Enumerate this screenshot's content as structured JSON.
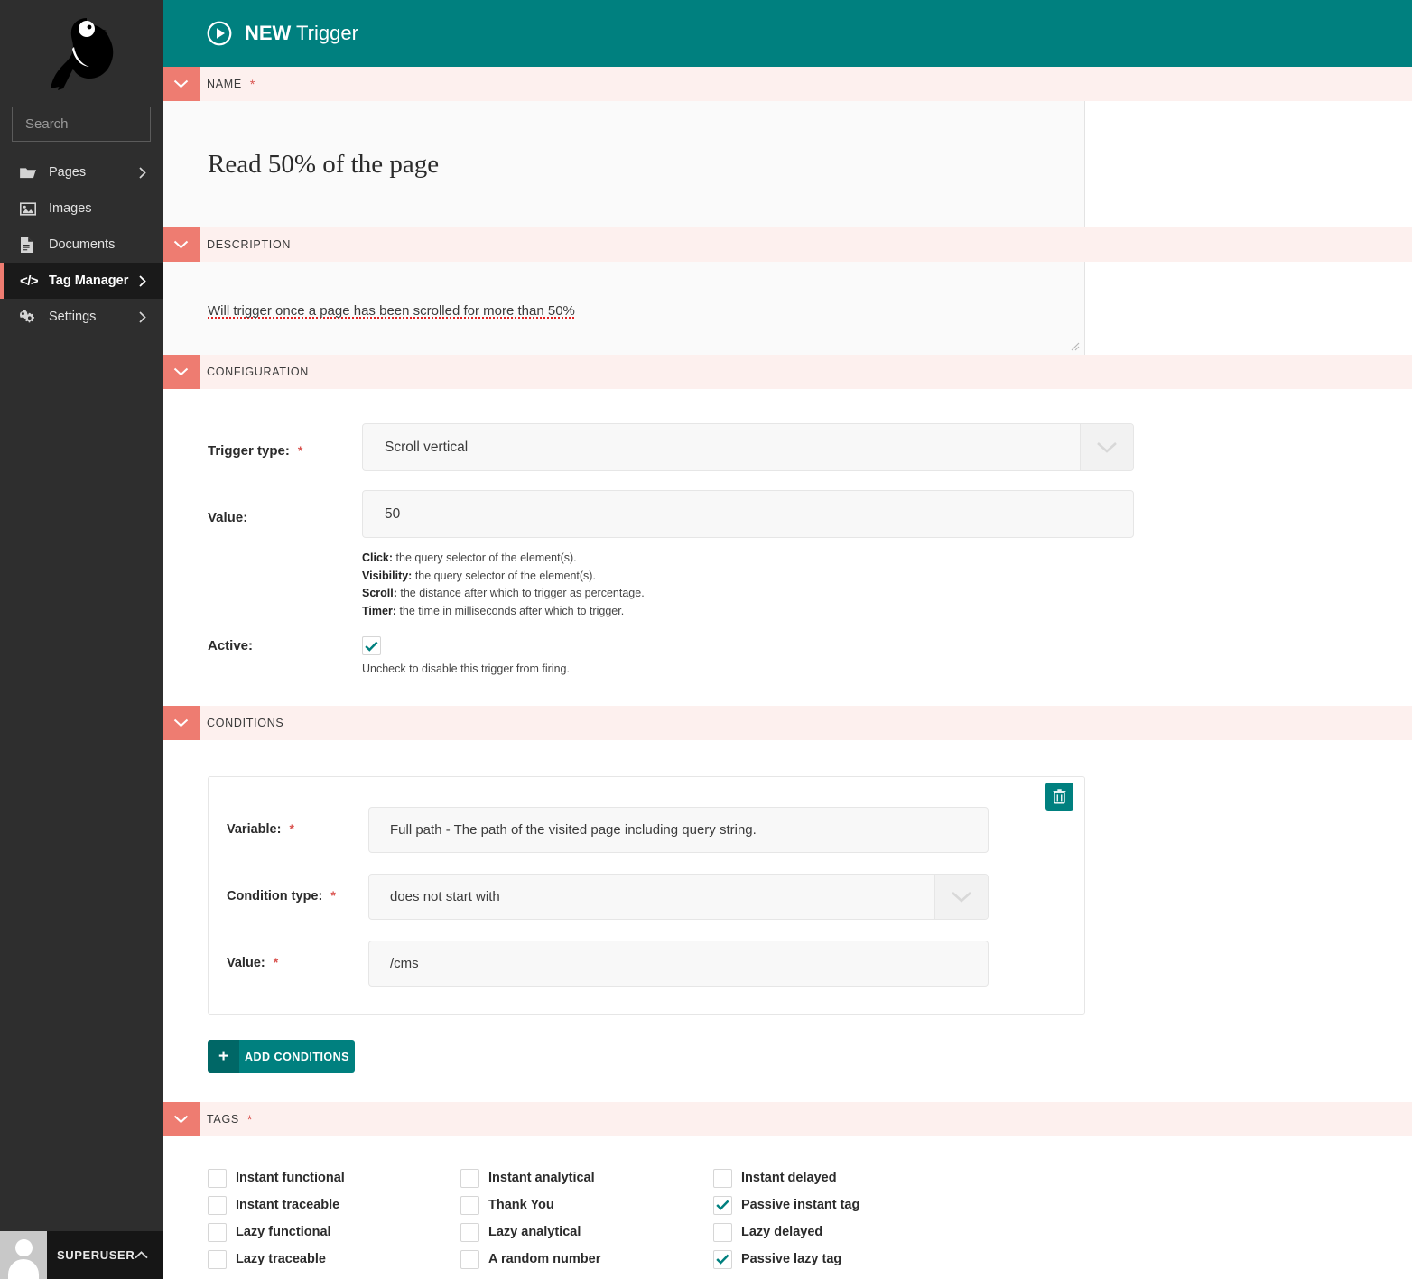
{
  "sidebar": {
    "logo": "bird-logo",
    "search": {
      "placeholder": "Search",
      "value": "",
      "icon": "search-icon"
    },
    "items": [
      {
        "label": "Pages",
        "icon": "folder-open-icon",
        "has_chevron": true,
        "active": false
      },
      {
        "label": "Images",
        "icon": "image-icon",
        "has_chevron": false,
        "active": false
      },
      {
        "label": "Documents",
        "icon": "document-icon",
        "has_chevron": false,
        "active": false
      },
      {
        "label": "Tag Manager",
        "icon": "code-icon",
        "has_chevron": true,
        "active": true
      },
      {
        "label": "Settings",
        "icon": "gears-icon",
        "has_chevron": true,
        "active": false
      }
    ],
    "user": {
      "name": "SUPERUSER",
      "chevron": "chevron-up-icon"
    }
  },
  "topbar": {
    "icon": "play-circle-icon",
    "title_bold": "NEW",
    "title_rest": " Trigger",
    "background": "#00807f"
  },
  "sections": {
    "name": {
      "title": "NAME",
      "required": true,
      "toggle": "chevron-down-icon"
    },
    "description": {
      "title": "DESCRIPTION",
      "required": false,
      "toggle": "chevron-down-icon"
    },
    "configuration": {
      "title": "CONFIGURATION",
      "required": false,
      "toggle": "chevron-down-icon"
    },
    "conditions": {
      "title": "CONDITIONS",
      "required": false,
      "toggle": "chevron-down-icon"
    },
    "tags": {
      "title": "TAGS",
      "required": true,
      "toggle": "chevron-down-icon"
    }
  },
  "name": {
    "value": "Read 50% of the page"
  },
  "description": {
    "value": "Will trigger once a page has been scrolled for more than 50%"
  },
  "configuration": {
    "trigger_type": {
      "label": "Trigger type:",
      "required": true,
      "value": "Scroll vertical",
      "arrow": "chevron-down-icon"
    },
    "value": {
      "label": "Value:",
      "required": false,
      "value": "50"
    },
    "hints": [
      {
        "term": "Click:",
        "text": " the query selector of the element(s)."
      },
      {
        "term": "Visibility:",
        "text": " the query selector of the element(s)."
      },
      {
        "term": "Scroll:",
        "text": " the distance after which to trigger as percentage."
      },
      {
        "term": "Timer:",
        "text": " the time in milliseconds after which to trigger."
      }
    ],
    "active": {
      "label": "Active:",
      "checked": true,
      "hint": "Uncheck to disable this trigger from firing."
    }
  },
  "conditions": {
    "delete_icon": "trash-icon",
    "rows": [
      {
        "label": "Variable:",
        "required": true,
        "value": "Full path - The path of the visited page including query string.",
        "type": "text"
      },
      {
        "label": "Condition type:",
        "required": true,
        "value": "does not start with",
        "type": "select"
      },
      {
        "label": "Value:",
        "required": true,
        "value": "/cms",
        "type": "text"
      }
    ],
    "add_button": {
      "label": "ADD CONDITIONS",
      "icon": "plus-icon"
    }
  },
  "tags": {
    "columns": [
      [
        {
          "label": "Instant functional",
          "checked": false
        },
        {
          "label": "Instant traceable",
          "checked": false
        },
        {
          "label": "Lazy functional",
          "checked": false
        },
        {
          "label": "Lazy traceable",
          "checked": false
        }
      ],
      [
        {
          "label": "Instant analytical",
          "checked": false
        },
        {
          "label": "Thank You",
          "checked": false
        },
        {
          "label": "Lazy analytical",
          "checked": false
        },
        {
          "label": "A random number",
          "checked": false
        }
      ],
      [
        {
          "label": "Instant delayed",
          "checked": false
        },
        {
          "label": "Passive instant tag",
          "checked": true
        },
        {
          "label": "Lazy delayed",
          "checked": false
        },
        {
          "label": "Passive lazy tag",
          "checked": true
        }
      ]
    ]
  },
  "colors": {
    "teal": "#00807f",
    "teal_dark": "#006766",
    "salmon": "#ee7c71",
    "section_band": "#fdf0ee",
    "sidebar": "#2e2e2e",
    "sidebar_active": "#1a1a1a",
    "required_red": "#d9534f"
  }
}
